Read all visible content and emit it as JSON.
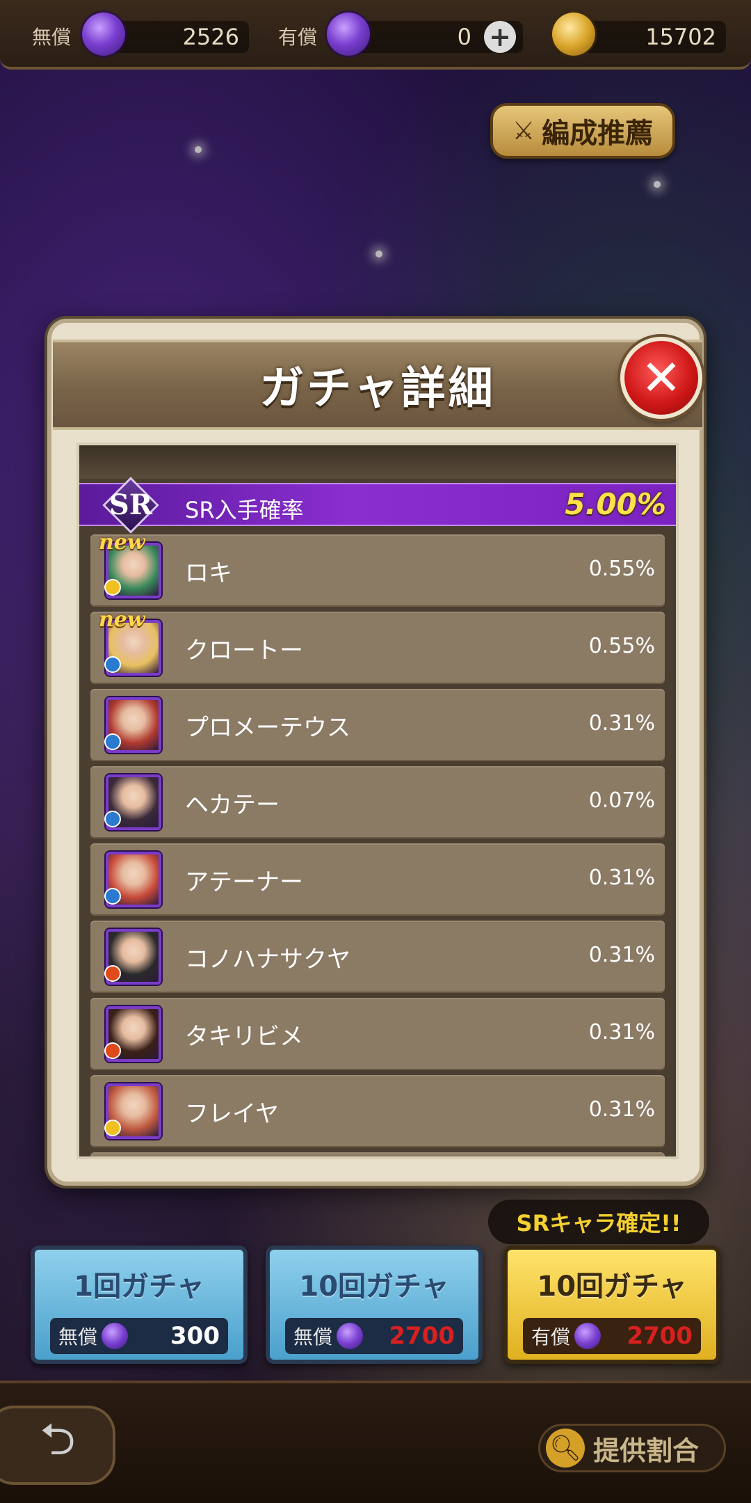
{
  "currency": {
    "free_label": "無償",
    "free_value": "2526",
    "paid_label": "有償",
    "paid_value": "0",
    "coin_value": "15702"
  },
  "formation_button": "編成推薦",
  "modal": {
    "title": "ガチャ詳細",
    "sr_label": "SR入手確率",
    "sr_emblem": "SR",
    "sr_rate": "5.00%",
    "characters": [
      {
        "name": "ロキ",
        "rate": "0.55%",
        "new": true,
        "new_label": "new",
        "element": "#f0c020",
        "art": "#3a8a5a"
      },
      {
        "name": "クロートー",
        "rate": "0.55%",
        "new": true,
        "new_label": "new",
        "element": "#2a7ad0",
        "art": "#e8c060"
      },
      {
        "name": "プロメーテウス",
        "rate": "0.31%",
        "new": false,
        "element": "#2a7ad0",
        "art": "#b03a30"
      },
      {
        "name": "ヘカテー",
        "rate": "0.07%",
        "new": false,
        "element": "#2a7ad0",
        "art": "#3a2a3a"
      },
      {
        "name": "アテーナー",
        "rate": "0.31%",
        "new": false,
        "element": "#2a7ad0",
        "art": "#c84a3a"
      },
      {
        "name": "コノハナサクヤ",
        "rate": "0.31%",
        "new": false,
        "element": "#e04a1a",
        "art": "#2a2a2a"
      },
      {
        "name": "タキリビメ",
        "rate": "0.31%",
        "new": false,
        "element": "#e04a1a",
        "art": "#3a2018"
      },
      {
        "name": "フレイヤ",
        "rate": "0.31%",
        "new": false,
        "element": "#f0c020",
        "art": "#c05a40"
      }
    ]
  },
  "sr_confirm": "SRキャラ確定!!",
  "gacha_buttons": [
    {
      "title": "1回ガチャ",
      "cost_label": "無償",
      "cost": "300",
      "red": false,
      "style": "blue"
    },
    {
      "title": "10回ガチャ",
      "cost_label": "無償",
      "cost": "2700",
      "red": true,
      "style": "blue"
    },
    {
      "title": "10回ガチャ",
      "cost_label": "有償",
      "cost": "2700",
      "red": true,
      "style": "gold"
    }
  ],
  "rates_button": "提供割合"
}
